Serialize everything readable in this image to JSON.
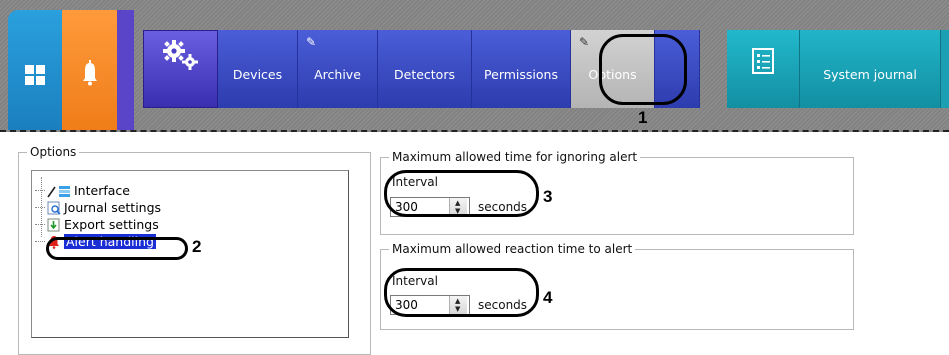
{
  "toolbar": {
    "tiles": [
      {
        "icon": "windows-grid-icon",
        "color": "#1f8fd0"
      },
      {
        "icon": "bell-icon",
        "color": "#f58a25"
      }
    ],
    "nav_tabs": [
      {
        "label": "Devices"
      },
      {
        "label": "Archive"
      },
      {
        "label": "Detectors"
      },
      {
        "label": "Permissions"
      },
      {
        "label": "Options"
      }
    ],
    "journal_label": "System journal",
    "colors": {
      "nav_blue": "#3a4cc4",
      "nav_selected": "#c4c4c4",
      "journal_teal": "#1aa6bb"
    }
  },
  "options_panel": {
    "legend": "Options",
    "tree": [
      {
        "label": "Interface",
        "icon": "interface-icon"
      },
      {
        "label": "Journal settings",
        "icon": "journal-settings-icon"
      },
      {
        "label": "Export settings",
        "icon": "export-icon"
      },
      {
        "label": "Alert handling",
        "icon": "alert-bell-icon",
        "selected": true
      }
    ]
  },
  "ignore_alert": {
    "legend": "Maximum allowed time for ignoring alert",
    "interval_label": "Interval",
    "value": "300",
    "unit": "seconds"
  },
  "reaction_alert": {
    "legend": "Maximum allowed reaction time to alert",
    "interval_label": "Interval",
    "value": "300",
    "unit": "seconds"
  },
  "callouts": {
    "one": "1",
    "two": "2",
    "three": "3",
    "four": "4"
  }
}
